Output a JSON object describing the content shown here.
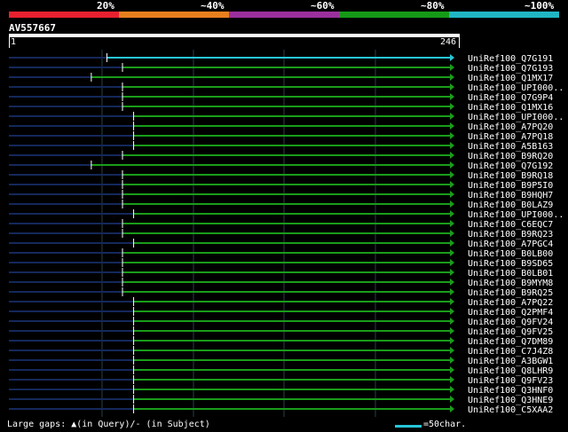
{
  "legend": [
    {
      "label": "20%",
      "color": "#e8202f"
    },
    {
      "label": "~40%",
      "color": "#e87f1e"
    },
    {
      "label": "~60%",
      "color": "#9b2f9d"
    },
    {
      "label": "~80%",
      "color": "#159a18"
    },
    {
      "label": "~100%",
      "color": "#20b6c4"
    }
  ],
  "query": {
    "id": "AV557667",
    "length_start": "1",
    "length_end": "246"
  },
  "colors": {
    "background": "#000000",
    "query_line": "#14285a",
    "hit_green": "#1a9c1a",
    "hit_cyan": "#26c6d8",
    "gridline": "#26404d"
  },
  "hits": [
    {
      "name": "UniRef100_Q7G191",
      "start": 0.22,
      "color": "cyan"
    },
    {
      "name": "UniRef100_Q7G193",
      "start": 0.255,
      "color": "green"
    },
    {
      "name": "UniRef100_Q1MX17",
      "start": 0.185,
      "color": "green"
    },
    {
      "name": "UniRef100_UPI000..",
      "start": 0.255,
      "color": "green"
    },
    {
      "name": "UniRef100_Q7G9P4",
      "start": 0.255,
      "color": "green"
    },
    {
      "name": "UniRef100_Q1MX16",
      "start": 0.255,
      "color": "green"
    },
    {
      "name": "UniRef100_UPI000..",
      "start": 0.28,
      "color": "green"
    },
    {
      "name": "UniRef100_A7PQ20",
      "start": 0.28,
      "color": "green"
    },
    {
      "name": "UniRef100_A7PQ18",
      "start": 0.28,
      "color": "green"
    },
    {
      "name": "UniRef100_A5B163",
      "start": 0.28,
      "color": "green"
    },
    {
      "name": "UniRef100_B9RQ20",
      "start": 0.255,
      "color": "green"
    },
    {
      "name": "UniRef100_Q7G192",
      "start": 0.185,
      "color": "green"
    },
    {
      "name": "UniRef100_B9RQ18",
      "start": 0.255,
      "color": "green"
    },
    {
      "name": "UniRef100_B9P5I0",
      "start": 0.255,
      "color": "green"
    },
    {
      "name": "UniRef100_B9HQH7",
      "start": 0.255,
      "color": "green"
    },
    {
      "name": "UniRef100_B0LAZ9",
      "start": 0.255,
      "color": "green"
    },
    {
      "name": "UniRef100_UPI000..",
      "start": 0.28,
      "color": "green"
    },
    {
      "name": "UniRef100_C6EQC7",
      "start": 0.255,
      "color": "green"
    },
    {
      "name": "UniRef100_B9RQ23",
      "start": 0.255,
      "color": "green"
    },
    {
      "name": "UniRef100_A7PGC4",
      "start": 0.28,
      "color": "green"
    },
    {
      "name": "UniRef100_B0LB00",
      "start": 0.255,
      "color": "green"
    },
    {
      "name": "UniRef100_B9SD65",
      "start": 0.255,
      "color": "green"
    },
    {
      "name": "UniRef100_B0LB01",
      "start": 0.255,
      "color": "green"
    },
    {
      "name": "UniRef100_B9MYM8",
      "start": 0.255,
      "color": "green"
    },
    {
      "name": "UniRef100_B9RQ25",
      "start": 0.255,
      "color": "green"
    },
    {
      "name": "UniRef100_A7PQ22",
      "start": 0.28,
      "color": "green"
    },
    {
      "name": "UniRef100_Q2PMF4",
      "start": 0.28,
      "color": "green"
    },
    {
      "name": "UniRef100_Q9FV24",
      "start": 0.28,
      "color": "green"
    },
    {
      "name": "UniRef100_Q9FV25",
      "start": 0.28,
      "color": "green"
    },
    {
      "name": "UniRef100_Q7DM89",
      "start": 0.28,
      "color": "green"
    },
    {
      "name": "UniRef100_C7J4Z8",
      "start": 0.28,
      "color": "green"
    },
    {
      "name": "UniRef100_A3BGW1",
      "start": 0.28,
      "color": "green"
    },
    {
      "name": "UniRef100_Q8LHR9",
      "start": 0.28,
      "color": "green"
    },
    {
      "name": "UniRef100_Q9FV23",
      "start": 0.28,
      "color": "green"
    },
    {
      "name": "UniRef100_Q3HNF0",
      "start": 0.28,
      "color": "green"
    },
    {
      "name": "UniRef100_Q3HNE9",
      "start": 0.28,
      "color": "green"
    },
    {
      "name": "UniRef100_C5XAA2",
      "start": 0.28,
      "color": "green"
    }
  ],
  "footer": {
    "gaps_note": "Large gaps: ▲(in Query)/- (in Subject)",
    "scale_text": "=50char."
  }
}
